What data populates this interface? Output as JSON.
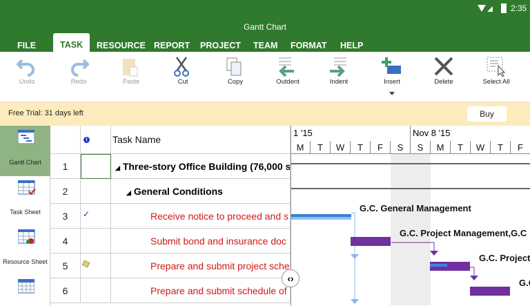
{
  "status": {
    "time": "2:35"
  },
  "app": {
    "title": "Gantt Chart"
  },
  "tabs": [
    "FILE",
    "TASK",
    "RESOURCE",
    "REPORT",
    "PROJECT",
    "TEAM",
    "FORMAT",
    "HELP"
  ],
  "toolbar": {
    "undo": "Undo",
    "redo": "Redo",
    "paste": "Paste",
    "cut": "Cut",
    "copy": "Copy",
    "outdent": "Outdent",
    "indent": "Indent",
    "insert": "Insert",
    "delete": "Delete",
    "select_all": "Select All"
  },
  "trial": {
    "text": "Free Trial: 31 days left",
    "buy": "Buy"
  },
  "views": [
    "Gantt Chart",
    "Task Sheet",
    "Resource Sheet"
  ],
  "grid": {
    "task_name_header": "Task Name",
    "info_icon": "i",
    "rows": [
      {
        "id": "1",
        "name": "Three-story Office Building (76,000 s",
        "level": 0
      },
      {
        "id": "2",
        "name": "General Conditions",
        "level": 1
      },
      {
        "id": "3",
        "name": "Receive notice to proceed and s",
        "level": 2,
        "indicator": "check"
      },
      {
        "id": "4",
        "name": "Submit bond and insurance doc",
        "level": 2
      },
      {
        "id": "5",
        "name": "Prepare and submit project sche",
        "level": 2,
        "indicator": "note"
      },
      {
        "id": "6",
        "name": "Prepare and submit schedule of",
        "level": 2
      }
    ]
  },
  "gantt": {
    "week1": "1 '15",
    "week2": "Nov 8 '15",
    "days": [
      "M",
      "T",
      "W",
      "T",
      "F",
      "S",
      "S",
      "M",
      "T",
      "W",
      "T",
      "F"
    ],
    "resources": [
      "G.C. General Management",
      "G.C. Project Management,G.C",
      "G.C. Project",
      "G.C"
    ],
    "colors": {
      "bar": "#7030a0",
      "progress": "#3a86d8",
      "weekend": "#ededed"
    }
  }
}
